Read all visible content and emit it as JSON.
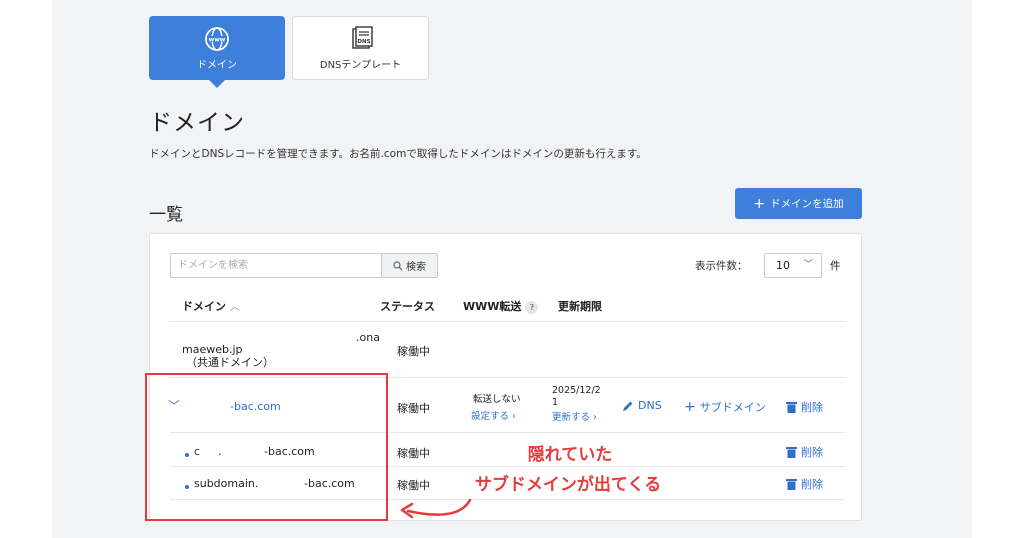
{
  "tabs": [
    {
      "label": "ドメイン",
      "icon": "www-globe-icon"
    },
    {
      "label": "DNSテンプレート",
      "icon": "dns-document-icon"
    }
  ],
  "page": {
    "title": "ドメイン",
    "description": "ドメインとDNSレコードを管理できます。お名前.comで取得したドメインはドメインの更新も行えます。",
    "list_title": "一覧",
    "add_button": "ドメインを追加"
  },
  "search": {
    "placeholder": "ドメインを検索",
    "button": "検索"
  },
  "pagination": {
    "label": "表示件数：",
    "value": "10",
    "unit": "件"
  },
  "table": {
    "headers": {
      "domain": "ドメイン",
      "status": "ステータス",
      "www": "WWW転送",
      "expiry": "更新期限"
    },
    "rows": [
      {
        "domain_suffix": ".ona",
        "domain": "maeweb.jp",
        "domain_note": "（共通ドメイン）",
        "status": "稼働中"
      },
      {
        "domain": "-bac.com",
        "status": "稼働中",
        "www_status": "転送しない",
        "www_link": "設定する ›",
        "expiry": "2025/12/2\n1",
        "renew_link": "更新する ›",
        "dns_action": "DNS",
        "sub_action": "サブドメイン",
        "delete_action": "削除"
      },
      {
        "domain_prefix": "c",
        "domain_mid": ".",
        "domain": "-bac.com",
        "status": "稼働中",
        "delete_action": "削除"
      },
      {
        "domain_prefix": "subdomain.",
        "domain": "-bac.com",
        "status": "稼働中",
        "delete_action": "削除"
      }
    ]
  },
  "annotation": {
    "line1": "隠れていた",
    "line2": "サブドメインが出てくる",
    "color": "#e53b3b"
  },
  "colors": {
    "accent": "#3d7fdb",
    "link": "#2d6fcf"
  }
}
